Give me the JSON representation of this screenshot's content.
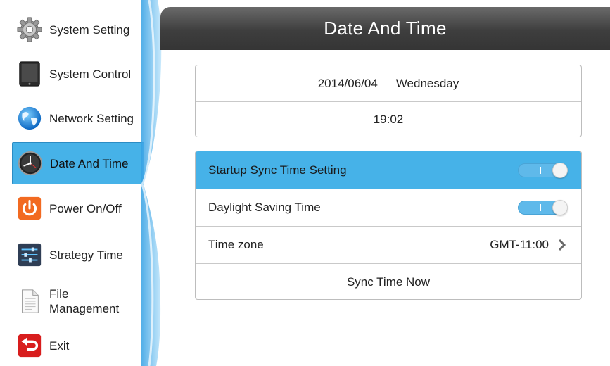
{
  "sidebar": {
    "items": [
      {
        "label": "System Setting",
        "icon": "gear-icon"
      },
      {
        "label": "System Control",
        "icon": "tablet-icon"
      },
      {
        "label": "Network Setting",
        "icon": "globe-icon"
      },
      {
        "label": "Date And Time",
        "icon": "clock-icon",
        "active": true
      },
      {
        "label": "Power On/Off",
        "icon": "power-icon"
      },
      {
        "label": "Strategy Time",
        "icon": "sliders-icon"
      },
      {
        "label": "File\nManagement",
        "icon": "document-icon"
      },
      {
        "label": "Exit",
        "icon": "exit-icon"
      }
    ]
  },
  "header": {
    "title": "Date And Time"
  },
  "datetime": {
    "date": "2014/06/04",
    "weekday": "Wednesday",
    "time": "19:02"
  },
  "settings": {
    "startup_sync": {
      "label": "Startup Sync Time Setting",
      "enabled": true
    },
    "daylight_saving": {
      "label": "Daylight Saving Time",
      "enabled": true
    },
    "time_zone": {
      "label": "Time zone",
      "value": "GMT-11:00"
    },
    "sync_now": {
      "label": "Sync Time Now"
    }
  },
  "colors": {
    "accent": "#46b2e8",
    "header": "#3e3e3e",
    "toggle_on": "#5fb9ea"
  }
}
